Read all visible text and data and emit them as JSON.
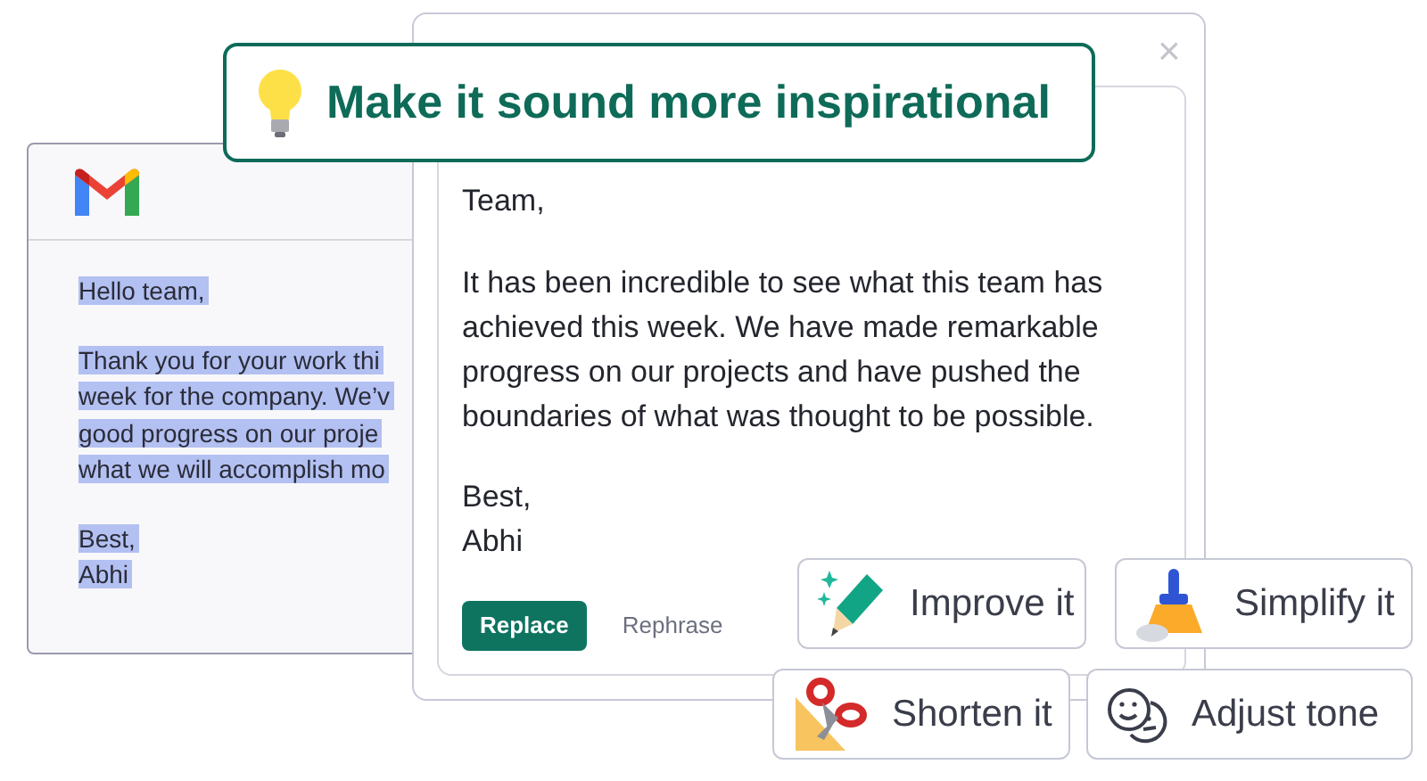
{
  "email": {
    "greeting": "Hello team,",
    "lines": [
      "Thank you for your work thi",
      "week for the company. We’v",
      "good progress on our proje",
      "what we will accomplish mo"
    ],
    "signoff": "Best,",
    "name": "Abhi",
    "selected": true
  },
  "prompt": {
    "text": "Make it sound more inspirational"
  },
  "dialog": {
    "greeting": "Team,",
    "paragraph": "It has been incredible to see what this team has achieved this week. We have made remarkable progress on our projects and have pushed the boundaries of what was thought to be possible.",
    "signoff": "Best,",
    "name": "Abhi",
    "close": "×",
    "buttons": [
      {
        "label": "Replace",
        "kind": "primary"
      },
      {
        "label": "Rephrase",
        "kind": "text"
      }
    ]
  },
  "actions": [
    {
      "label": "Improve it",
      "kind": "improve"
    },
    {
      "label": "Simplify it",
      "kind": "simplify"
    },
    {
      "label": "Shorten it",
      "kind": "shorten"
    },
    {
      "label": "Adjust tone",
      "kind": "tone"
    }
  ]
}
